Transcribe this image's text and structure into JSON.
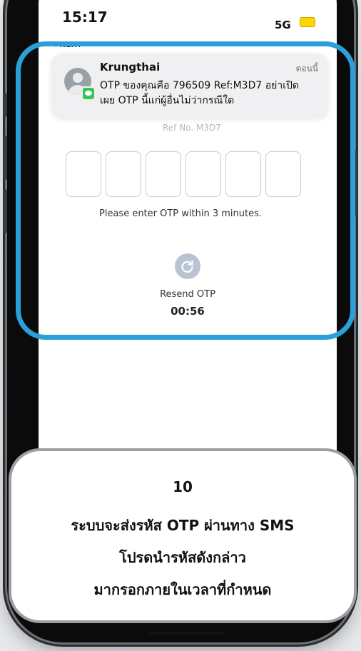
{
  "status_bar": {
    "time": "15:17",
    "carrier": "5G",
    "back_label": "◂ NEXT"
  },
  "notification": {
    "sender": "Krungthai",
    "when": "ตอนนี้",
    "line1": "OTP ของคุณคือ 796509 Ref:M3D7 อย่าเปิด",
    "line2": "เผย OTP นี้แก่ผู้อื่นไม่ว่ากรณีใด"
  },
  "otp_screen": {
    "ref_no": "Ref No. M3D7",
    "boxes": [
      "",
      "",
      "",
      "",
      "",
      ""
    ],
    "hint": "Please enter OTP within 3 minutes.",
    "resend_label": "Resend OTP",
    "countdown": "00:56"
  },
  "caption": {
    "step": "10",
    "line1": "ระบบจะส่งรหัส OTP ผ่านทาง SMS",
    "line2": "โปรดนำรหัสดังกล่าว",
    "line3": "มากรอกภายในเวลาที่กำหนด"
  },
  "colors": {
    "highlight": "#2b9fd9",
    "resend_button": "#b9c4d2",
    "caption_border": "#9d9fa3"
  }
}
